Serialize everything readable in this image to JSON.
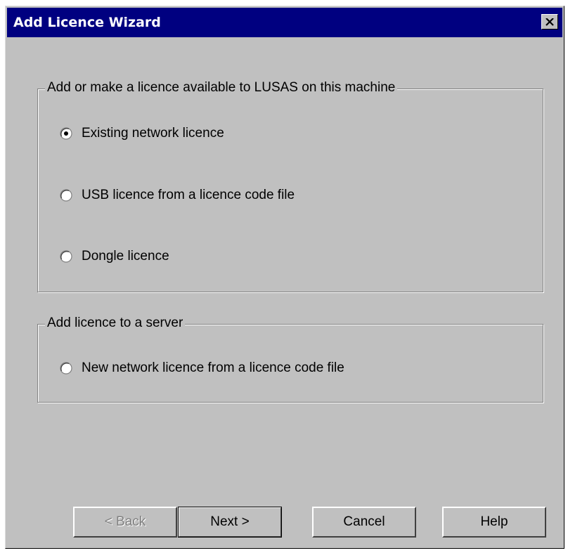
{
  "window": {
    "title": "Add Licence Wizard"
  },
  "group_machine": {
    "legend": "Add or make a licence available to LUSAS on this machine",
    "options": [
      {
        "label": "Existing network licence",
        "checked": true
      },
      {
        "label": "USB licence from a licence code file",
        "checked": false
      },
      {
        "label": "Dongle licence",
        "checked": false
      }
    ]
  },
  "group_server": {
    "legend": "Add licence to a server",
    "options": [
      {
        "label": "New network licence from a licence code file",
        "checked": false
      }
    ]
  },
  "buttons": {
    "back": "< Back",
    "next": "Next >",
    "cancel": "Cancel",
    "help": "Help"
  },
  "colors": {
    "titlebar": "#000080",
    "face": "#c0c0c0"
  }
}
